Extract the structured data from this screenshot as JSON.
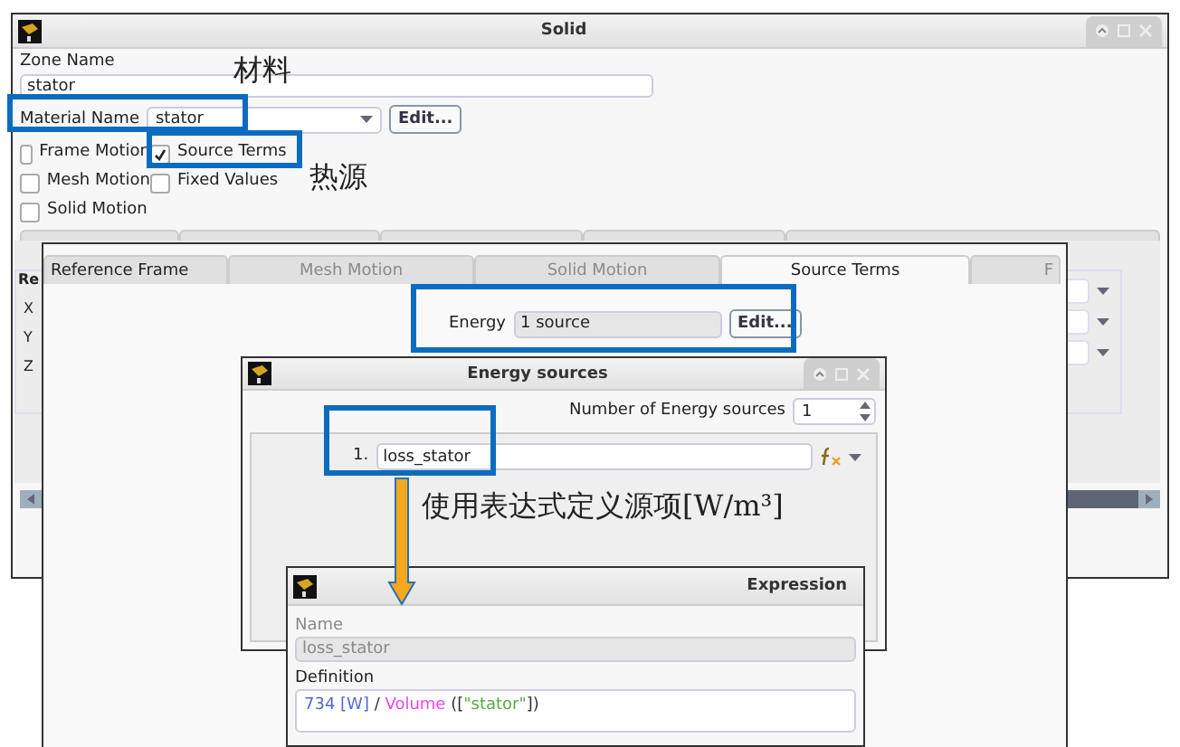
{
  "solid_window": {
    "title": "Solid",
    "zone_name": {
      "label": "Zone Name",
      "value": "stator"
    },
    "material": {
      "label": "Material Name",
      "value": "stator",
      "button": "Edit..."
    },
    "checkboxes": [
      {
        "label": "Frame Motion",
        "checked": false
      },
      {
        "label": "Source Terms",
        "checked": true
      },
      {
        "label": "Mesh Motion",
        "checked": false
      },
      {
        "label": "Fixed Values",
        "checked": false
      },
      {
        "label": "Solid Motion",
        "checked": false
      }
    ],
    "group_label": "Re",
    "axes": [
      "X",
      "Y",
      "Z"
    ]
  },
  "source_terms_panel": {
    "tabs": [
      {
        "label": "Reference Frame",
        "selected": false,
        "disabled": false
      },
      {
        "label": "Mesh Motion",
        "selected": false,
        "disabled": true
      },
      {
        "label": "Solid Motion",
        "selected": false,
        "disabled": true
      },
      {
        "label": "Source Terms",
        "selected": true,
        "disabled": false
      },
      {
        "label": "F",
        "selected": false,
        "disabled": true
      }
    ],
    "energy": {
      "label": "Energy",
      "value": "1 source",
      "button": "Edit..."
    }
  },
  "energy_sources_window": {
    "title": "Energy sources",
    "count_label": "Number of Energy sources",
    "count": "1",
    "sources": [
      {
        "index": "1.",
        "value": "loss_stator"
      }
    ]
  },
  "expression_window": {
    "title": "Expression",
    "name_label": "Name",
    "name_value": "loss_stator",
    "definition_label": "Definition",
    "definition": [
      {
        "kind": "number",
        "text": "734"
      },
      {
        "kind": "unit",
        "text": " [W]"
      },
      {
        "kind": "operator",
        "text": " / "
      },
      {
        "kind": "function",
        "text": "Volume"
      },
      {
        "kind": "bracket",
        "text": " (["
      },
      {
        "kind": "string",
        "text": "\"stator\""
      },
      {
        "kind": "bracket",
        "text": "])"
      }
    ]
  },
  "annotations": [
    {
      "text": "材料"
    },
    {
      "text": "热源"
    },
    {
      "text": "使用表达式定义源项[W/m³]"
    }
  ]
}
